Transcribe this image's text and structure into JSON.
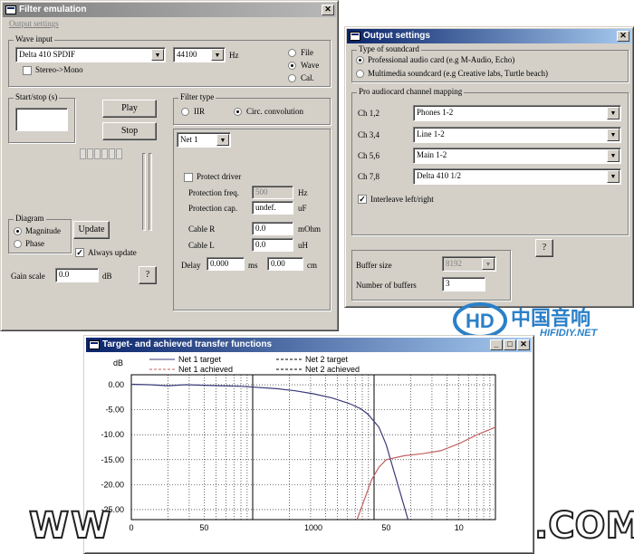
{
  "filter_window": {
    "title": "Filter emulation",
    "menu": "Output settings",
    "wave_input": {
      "label": "Wave input",
      "device": "Delta 410 SPDIF",
      "rate": "44100",
      "rate_unit": "Hz",
      "stereo_to_mono": "Stereo->Mono",
      "sources": [
        "File",
        "Wave",
        "Cal."
      ]
    },
    "start_stop": {
      "label": "Start/stop (s)",
      "play": "Play",
      "stop": "Stop"
    },
    "filter_type": {
      "label": "Filter type",
      "options": [
        "IIR",
        "Circ. convolution"
      ],
      "net": "Net 1"
    },
    "protect": {
      "label": "Protect driver",
      "freq_label": "Protection freq.",
      "freq": "500",
      "freq_unit": "Hz",
      "cap_label": "Protection cap.",
      "cap": "undef.",
      "cap_unit": "uF"
    },
    "cable_r": {
      "label": "Cable R",
      "value": "0.0",
      "unit": "mOhm"
    },
    "cable_l": {
      "label": "Cable L",
      "value": "0.0",
      "unit": "uH"
    },
    "delay": {
      "label": "Delay",
      "value1": "0.000",
      "unit1": "ms",
      "value2": "0.00",
      "unit2": "cm"
    },
    "diagram": {
      "label": "Diagram",
      "options": [
        "Magnitude",
        "Phase"
      ],
      "update": "Update",
      "always_update": "Always update"
    },
    "gain": {
      "label": "Gain scale",
      "value": "0.0",
      "unit": "dB"
    },
    "help": "?"
  },
  "output_window": {
    "title": "Output settings",
    "soundcard": {
      "label": "Type of soundcard",
      "options": [
        "Professional audio card (e.g M-Audio, Echo)",
        "Multimedia soundcard (e.g Creative labs, Turtle beach)"
      ]
    },
    "mapping": {
      "label": "Pro audiocard channel mapping",
      "rows": [
        {
          "ch": "Ch 1,2",
          "value": "Phones 1-2"
        },
        {
          "ch": "Ch 3,4",
          "value": "Line 1-2"
        },
        {
          "ch": "Ch 5,6",
          "value": "Main 1-2"
        },
        {
          "ch": "Ch 7,8",
          "value": "Delta 410 1/2"
        }
      ],
      "interleave": "Interleave left/right"
    },
    "help": "?",
    "buffer_size": {
      "label": "Buffer size",
      "value": "8192"
    },
    "num_buffers": {
      "label": "Number of buffers",
      "value": "3"
    }
  },
  "graph_window": {
    "title": "Target- and achieved transfer functions"
  },
  "watermark": {
    "logo_cn": "中国音响",
    "logo_url": "HIFIDIY.NET",
    "bottom_left": "WW",
    "bottom_right": ".COM"
  },
  "colors": {
    "target": "#3a3a7a",
    "achieved": "#c06060",
    "grid": "#000000"
  },
  "chart_data": {
    "type": "line",
    "ylabel": "dB",
    "yticks": [
      "0.00",
      "-5.00",
      "-10.00",
      "-15.00",
      "-20.00",
      "-25.00"
    ],
    "ylim": [
      -27,
      2
    ],
    "xticks": [
      "0",
      "50",
      "1000",
      "50",
      "10"
    ],
    "legend": [
      "Net 1 target",
      "Net 1 achieved",
      "Net 2 target",
      "Net 2 achieved"
    ],
    "grid": true,
    "series": [
      {
        "name": "Net 1 target",
        "points": [
          [
            0,
            0.1
          ],
          [
            0.05,
            0
          ],
          [
            0.1,
            -0.2
          ],
          [
            0.15,
            0
          ],
          [
            0.2,
            -0.1
          ],
          [
            0.3,
            -0.3
          ],
          [
            0.4,
            -0.8
          ],
          [
            0.45,
            -1.2
          ],
          [
            0.5,
            -1.8
          ],
          [
            0.55,
            -2.6
          ],
          [
            0.6,
            -3.8
          ],
          [
            0.63,
            -4.8
          ],
          [
            0.65,
            -5.9
          ],
          [
            0.68,
            -8.5
          ],
          [
            0.7,
            -12
          ],
          [
            0.72,
            -17
          ],
          [
            0.74,
            -22
          ],
          [
            0.76,
            -27
          ]
        ]
      },
      {
        "name": "Net 1 achieved",
        "points": [
          [
            0.62,
            -27
          ],
          [
            0.64,
            -23
          ],
          [
            0.66,
            -19
          ],
          [
            0.68,
            -16.5
          ],
          [
            0.7,
            -15
          ],
          [
            0.75,
            -14.2
          ],
          [
            0.8,
            -13.8
          ],
          [
            0.85,
            -13.2
          ],
          [
            0.9,
            -11.8
          ],
          [
            0.95,
            -10
          ],
          [
            1.0,
            -8.5
          ]
        ]
      }
    ]
  }
}
